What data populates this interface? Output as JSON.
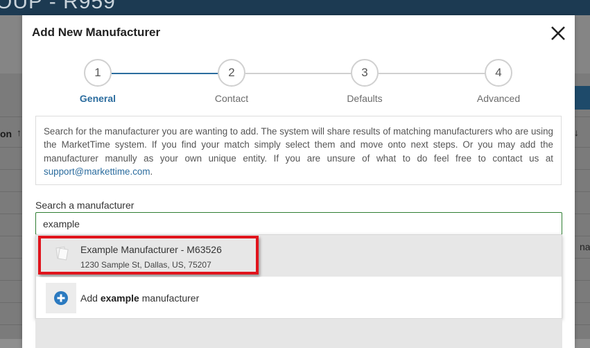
{
  "background": {
    "header_title": "OUP - R959",
    "column_label": "on",
    "sort_glyph": "↑",
    "right_button_label": "ve",
    "right_sort_glyph": "↓",
    "right_cell_text": "na"
  },
  "modal": {
    "title": "Add New Manufacturer",
    "close_icon": "close-icon"
  },
  "stepper": {
    "steps": [
      {
        "number": "1",
        "label": "General"
      },
      {
        "number": "2",
        "label": "Contact"
      },
      {
        "number": "3",
        "label": "Defaults"
      },
      {
        "number": "4",
        "label": "Advanced"
      }
    ],
    "active_index": 0,
    "active_color": "#2b6c9e",
    "inactive_color": "#d0d0d0"
  },
  "info": {
    "text": "Search for the manufacturer you are wanting to add. The system will share results of matching manufacturers who are using the MarketTime system. If you find your match simply select them and move onto next steps. Or you may add the manufacturer manully as your own unique entity. If you are unsure of what to do feel free to contact us at ",
    "email": "support@markettime.com",
    "suffix": "."
  },
  "search": {
    "label": "Search a manufacturer",
    "value": "example"
  },
  "results": [
    {
      "name": "Example Manufacturer - M63526",
      "address": "1230 Sample St, Dallas, US, 75207",
      "icon": "document-stack-icon"
    }
  ],
  "add_option": {
    "prefix": "Add ",
    "term": "example",
    "suffix": " manufacturer",
    "icon": "plus-circle-icon"
  },
  "colors": {
    "highlight": "#e0141c",
    "input_focus": "#2e7d32",
    "plus_icon": "#2b7ac0"
  }
}
